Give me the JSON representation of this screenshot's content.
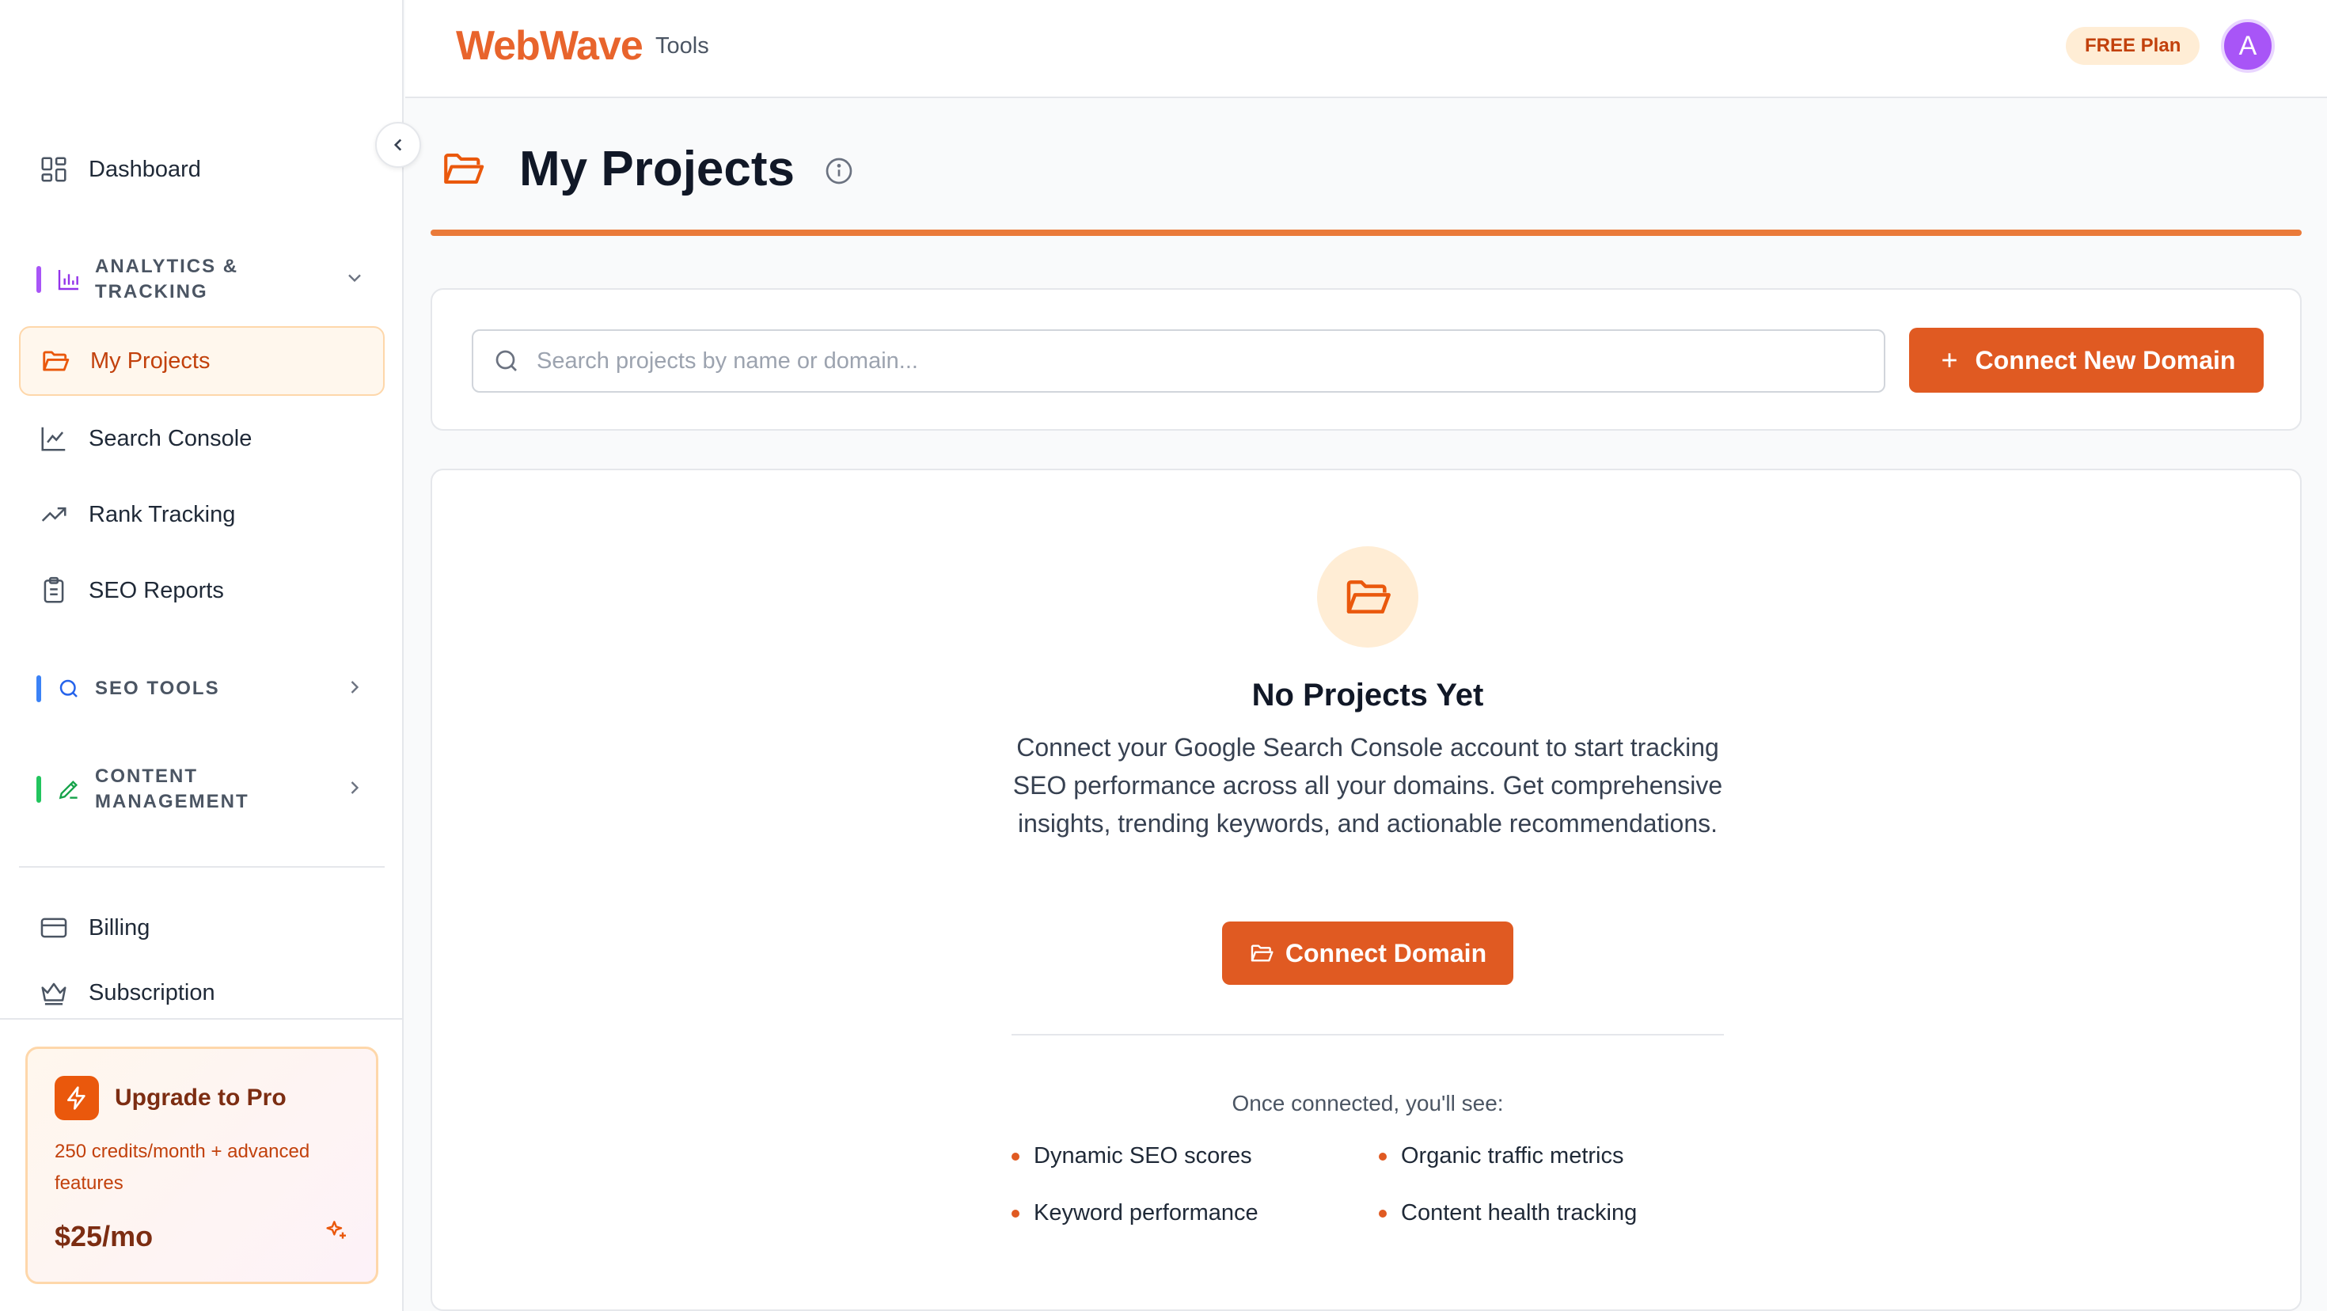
{
  "header": {
    "brand": "WebWave",
    "brand_sub": "Tools",
    "plan_badge": "FREE Plan",
    "avatar_initial": "A"
  },
  "sidebar": {
    "dashboard": "Dashboard",
    "groups": {
      "analytics": "ANALYTICS & TRACKING",
      "seo_tools": "SEO TOOLS",
      "content": "CONTENT MANAGEMENT"
    },
    "items": {
      "my_projects": "My Projects",
      "search_console": "Search Console",
      "rank_tracking": "Rank Tracking",
      "seo_reports": "SEO Reports",
      "billing": "Billing",
      "subscription": "Subscription"
    },
    "upgrade": {
      "title": "Upgrade to Pro",
      "description": "250 credits/month + advanced features",
      "price": "$25/mo"
    }
  },
  "page": {
    "title": "My Projects"
  },
  "search": {
    "placeholder": "Search projects by name or domain...",
    "value": ""
  },
  "actions": {
    "connect_new_domain": "Connect New Domain",
    "connect_domain": "Connect Domain"
  },
  "empty_state": {
    "title": "No Projects Yet",
    "description": "Connect your Google Search Console account to start tracking SEO performance across all your domains. Get comprehensive insights, trending keywords, and actionable recommendations.",
    "once_connected": "Once connected, you'll see:",
    "features": [
      "Dynamic SEO scores",
      "Organic traffic metrics",
      "Keyword performance",
      "Content health tracking"
    ]
  },
  "colors": {
    "accent": "#e05a22",
    "brand": "#e8642c",
    "analytics_bar": "#a855f7",
    "seo_bar": "#3b82f6",
    "content_bar": "#22c55e",
    "avatar": "#a855f7"
  },
  "icons": {
    "dashboard": "grid-icon",
    "analytics": "bar-chart-icon",
    "my_projects": "folder-open-icon",
    "search_console": "line-chart-icon",
    "rank_tracking": "trending-up-icon",
    "seo_reports": "clipboard-icon",
    "seo_tools": "search-icon",
    "content": "pencil-icon",
    "billing": "credit-card-icon",
    "subscription": "crown-icon",
    "upgrade": "bolt-icon",
    "sparkle": "sparkle-icon"
  }
}
